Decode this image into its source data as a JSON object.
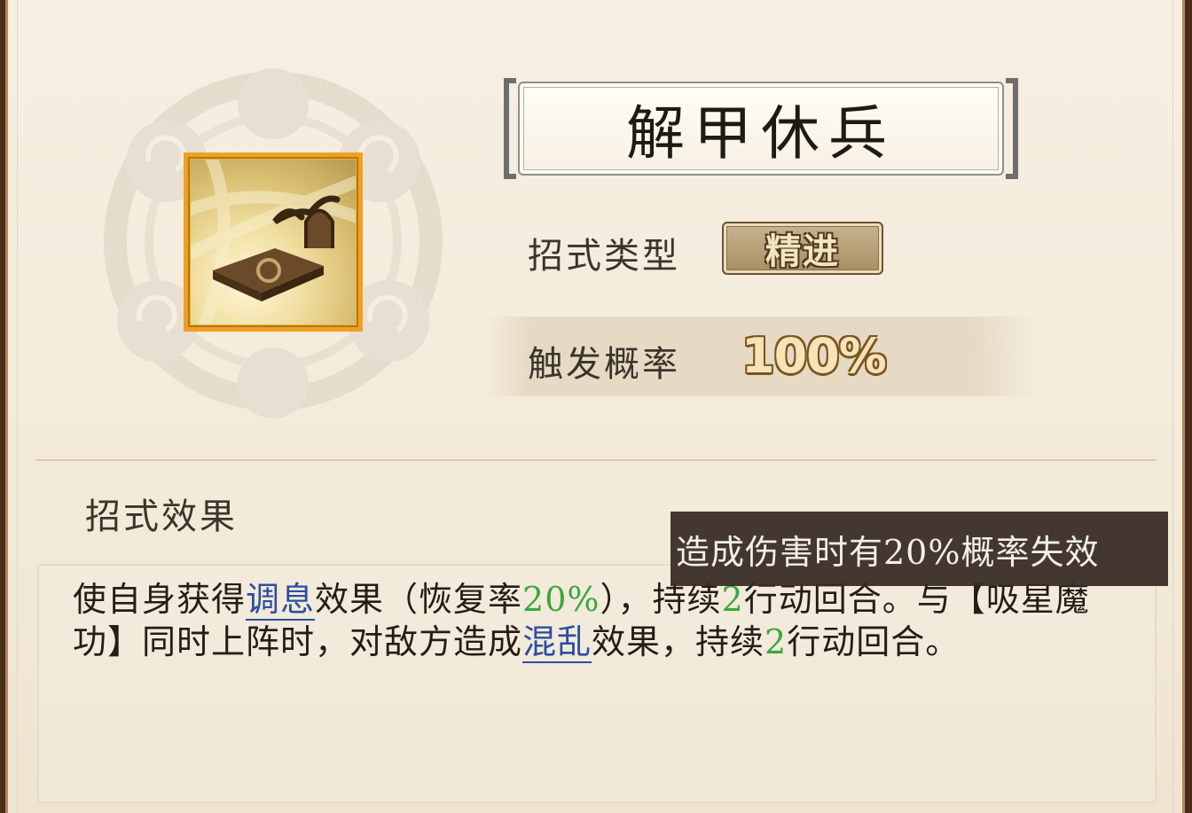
{
  "skill": {
    "name": "解甲休兵",
    "icon": "armor-rest-skill-icon"
  },
  "attributes": {
    "type_label": "招式类型",
    "type_value": "精进",
    "rate_label": "触发概率",
    "rate_value": "100%"
  },
  "effect": {
    "section_label": "招式效果",
    "segments": [
      {
        "text": "使自身获得",
        "style": "plain"
      },
      {
        "text": "调息",
        "style": "keyword"
      },
      {
        "text": "效果（恢复率",
        "style": "plain"
      },
      {
        "text": "20%",
        "style": "number"
      },
      {
        "text": "），持续",
        "style": "plain"
      },
      {
        "text": "2",
        "style": "number"
      },
      {
        "text": "行动回合。与【吸星魔功】同时上阵时，对敌方造成",
        "style": "plain"
      },
      {
        "text": "混乱",
        "style": "keyword"
      },
      {
        "text": "效果，持续",
        "style": "plain"
      },
      {
        "text": "2",
        "style": "number"
      },
      {
        "text": "行动回合。",
        "style": "plain"
      }
    ]
  },
  "tooltip": {
    "text": "造成伤害时有20%概率失效"
  },
  "colors": {
    "keyword": "#2a4fa0",
    "number": "#3aa83a",
    "badge": "#a88d62",
    "icon_frame": "#f0a020"
  }
}
